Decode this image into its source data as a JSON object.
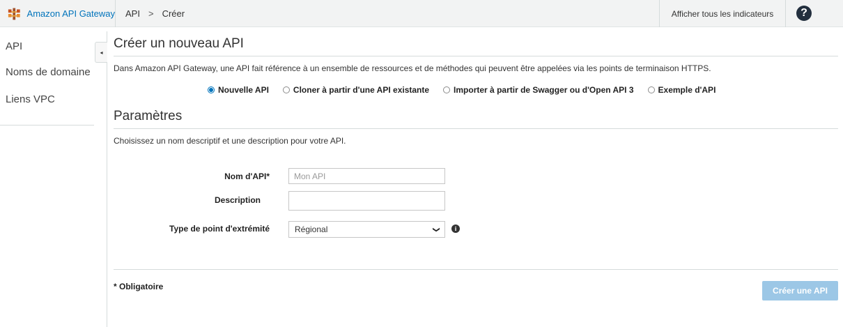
{
  "topbar": {
    "brand_name": "Amazon API Gateway",
    "breadcrumb": [
      "API",
      "Créer"
    ],
    "breadcrumb_separator": ">",
    "metrics_label": "Afficher tous les indicateurs",
    "help_icon": "?"
  },
  "sidebar": {
    "items": [
      {
        "label": "API"
      },
      {
        "label": "Noms de domaine"
      },
      {
        "label": "Liens VPC"
      }
    ],
    "collapse_icon": "◂"
  },
  "main": {
    "title": "Créer un nouveau API",
    "description": "Dans Amazon API Gateway, une API fait référence à un ensemble de ressources et de méthodes qui peuvent être appelées via les points de terminaison HTTPS.",
    "options": [
      {
        "label": "Nouvelle API",
        "checked": true
      },
      {
        "label": "Cloner à partir d'une API existante",
        "checked": false
      },
      {
        "label": "Importer à partir de Swagger ou d'Open API 3",
        "checked": false
      },
      {
        "label": "Exemple d'API",
        "checked": false
      }
    ],
    "settings_title": "Paramètres",
    "settings_description": "Choisissez un nom descriptif et une description pour votre API.",
    "fields": {
      "name_label": "Nom d'API*",
      "name_placeholder": "Mon API",
      "name_value": "",
      "description_label": "Description",
      "description_value": "",
      "endpoint_label": "Type de point d'extrémité",
      "endpoint_value": "Régional",
      "info_icon": "i"
    },
    "required_note": "* Obligatoire",
    "create_button": "Créer une API"
  },
  "colors": {
    "accent": "#0073bb",
    "button_disabled": "#9cc7e6",
    "topbar_bg": "#f2f3f3",
    "help_bg": "#232f3e"
  }
}
